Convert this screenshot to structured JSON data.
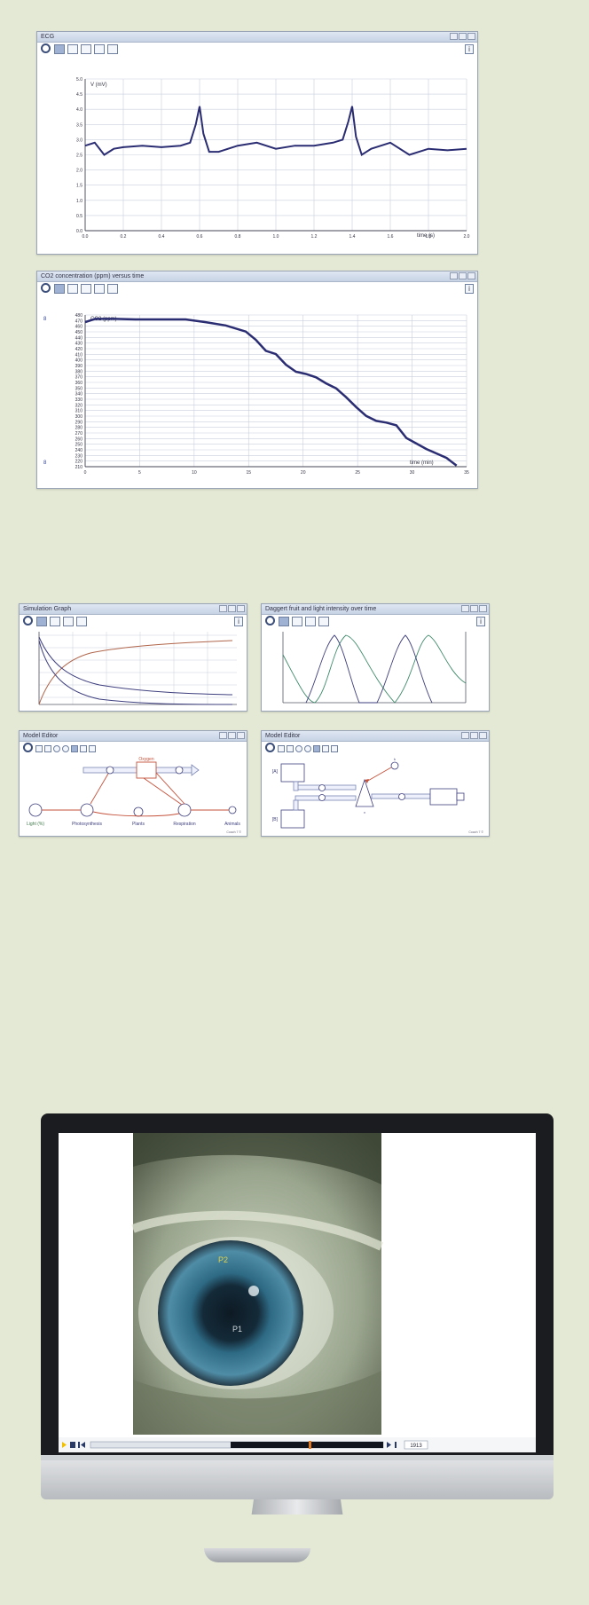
{
  "ecg_window": {
    "title": "ECG",
    "y_axis_label": "V (mV)",
    "x_axis_label": "time (s)",
    "y_ticks": [
      "5.0",
      "4.5",
      "4.0",
      "3.5",
      "3.0",
      "2.5",
      "2.0",
      "1.5",
      "1.0",
      "0.5",
      "0.0"
    ],
    "x_ticks": [
      "0.0",
      "0.2",
      "0.4",
      "0.6",
      "0.8",
      "1.0",
      "1.2",
      "1.4",
      "1.6",
      "1.8",
      "2.0"
    ]
  },
  "co2_window": {
    "title": "CO2 concentration (ppm) versus time",
    "y_axis_label": "CO2 (ppm)",
    "x_axis_label": "time (min)",
    "y_ticks": [
      "480",
      "470",
      "460",
      "450",
      "440",
      "430",
      "420",
      "410",
      "400",
      "390",
      "380",
      "370",
      "360",
      "350",
      "340",
      "330",
      "320",
      "310",
      "300",
      "290",
      "280",
      "270",
      "260",
      "250",
      "240",
      "230",
      "220",
      "210"
    ],
    "x_ticks": [
      "0",
      "5",
      "10",
      "15",
      "20",
      "25",
      "30",
      "35"
    ]
  },
  "graph3_window": {
    "title": "Simulation Graph"
  },
  "graph4_window": {
    "title": "Daggert fruit and light intensity over time"
  },
  "model1_window": {
    "title": "Model Editor",
    "nodes": {
      "oxygen": "Oxygen",
      "light": "Light (%)",
      "photosynthesis": "Photosynthesis",
      "plants": "Plants",
      "respiration": "Respiration",
      "animals": "Animals"
    },
    "footer": "Coach 7 ©"
  },
  "model2_window": {
    "title": "Model Editor",
    "nodes": {
      "a": "[A]",
      "b": "[B]",
      "k": "k",
      "v": "v"
    },
    "footer": "Coach 7 ©"
  },
  "video_player": {
    "time": "1913",
    "frame_labels": [
      "P2",
      "P1"
    ]
  },
  "chart_data": [
    {
      "type": "line",
      "title": "ECG",
      "xlabel": "time (s)",
      "ylabel": "V (mV)",
      "xlim": [
        0,
        2.0
      ],
      "ylim": [
        0,
        5.0
      ],
      "series": [
        {
          "x": [
            0.0,
            0.05,
            0.1,
            0.15,
            0.2,
            0.3,
            0.4,
            0.5,
            0.55,
            0.58,
            0.6,
            0.62,
            0.65,
            0.7,
            0.8,
            0.9,
            1.0,
            1.1,
            1.2,
            1.3,
            1.35,
            1.38,
            1.4,
            1.42,
            1.45,
            1.5,
            1.6,
            1.7,
            1.8,
            1.9,
            2.0
          ],
          "y": [
            2.8,
            2.9,
            2.5,
            2.7,
            2.75,
            2.8,
            2.75,
            2.8,
            2.9,
            3.5,
            4.1,
            3.2,
            2.6,
            2.6,
            2.8,
            2.9,
            2.7,
            2.8,
            2.8,
            2.9,
            3.0,
            3.6,
            4.1,
            3.1,
            2.5,
            2.7,
            2.9,
            2.5,
            2.7,
            2.65,
            2.7
          ]
        }
      ]
    },
    {
      "type": "line",
      "title": "CO2 concentration (ppm) versus time",
      "xlabel": "time (min)",
      "ylabel": "CO2 (ppm)",
      "xlim": [
        0,
        38
      ],
      "ylim": [
        210,
        485
      ],
      "series": [
        {
          "x": [
            0,
            1,
            3,
            5,
            8,
            10,
            12,
            14,
            16,
            17,
            18,
            19,
            20,
            21,
            22,
            23,
            24,
            25,
            26,
            27,
            28,
            29,
            30,
            31,
            32,
            33,
            34,
            35,
            36,
            37
          ],
          "y": [
            472,
            478,
            478,
            477,
            477,
            477,
            472,
            466,
            455,
            440,
            420,
            414,
            395,
            382,
            378,
            372,
            361,
            352,
            336,
            318,
            302,
            293,
            290,
            285,
            262,
            252,
            242,
            234,
            226,
            212
          ]
        }
      ]
    }
  ]
}
